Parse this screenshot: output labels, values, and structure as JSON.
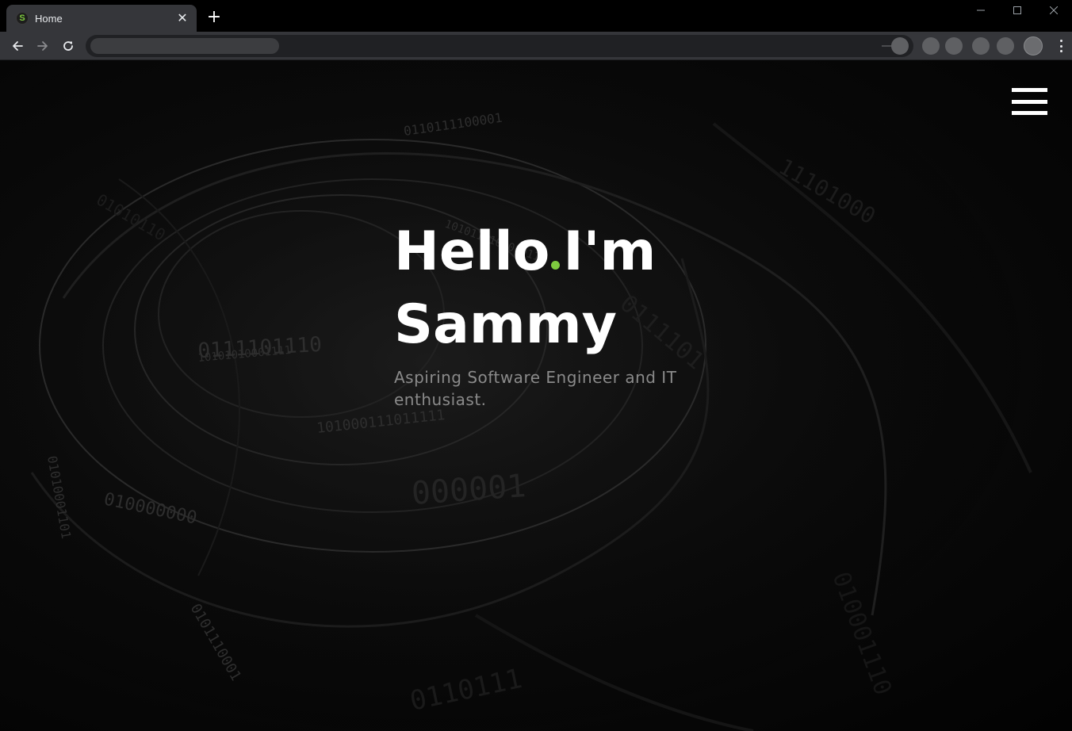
{
  "browser": {
    "tab": {
      "favicon_letter": "S",
      "title": "Home",
      "close_symbol": "✕"
    },
    "new_tab_symbol": "+"
  },
  "page": {
    "hero": {
      "greeting": "Hello",
      "intro": "I'm",
      "name": "Sammy",
      "tagline": "Aspiring Software Engineer and IT enthusiast."
    }
  },
  "colors": {
    "accent": "#7ecb3f",
    "page_background": "#000000",
    "title_text": "#ffffff",
    "tagline_text": "#8a8a8a",
    "toolbar": "#35363a"
  },
  "icons": {
    "back": "back-arrow-icon",
    "forward": "forward-arrow-icon",
    "reload": "reload-icon",
    "menu": "hamburger-menu-icon",
    "browser_menu": "more-vert-icon"
  }
}
